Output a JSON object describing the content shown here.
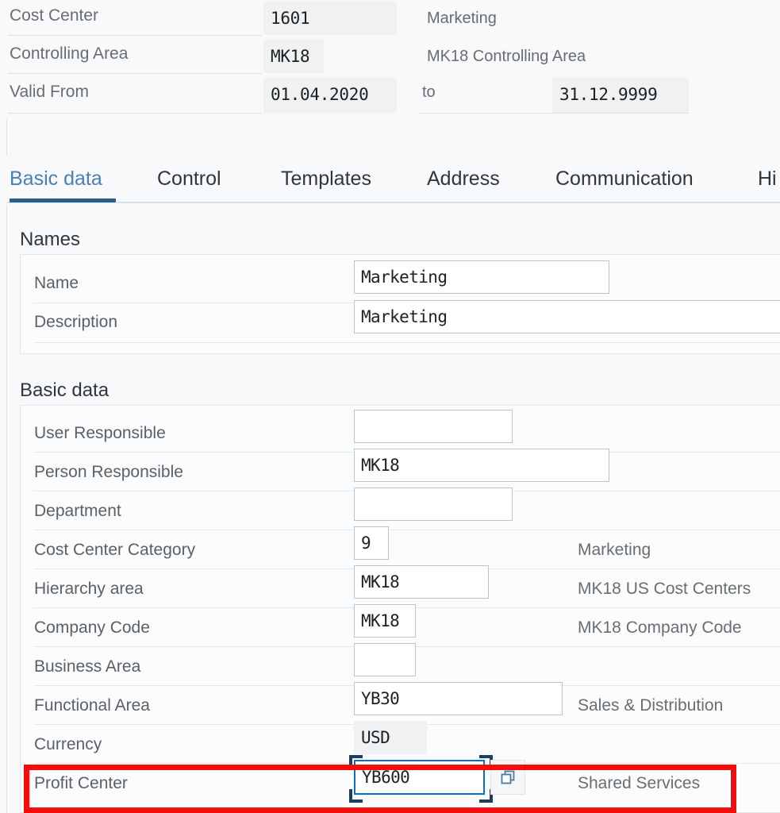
{
  "theme": {
    "page_bg": "#f7f9fb",
    "accent_blue": "#0a6ed1",
    "tab_active_text": "#4a7fb5",
    "tab_marker": "#2b5d8b",
    "label_gray": "#5c6064",
    "desc_gray": "#6a6d70",
    "readonly_bg": "#eff1f3",
    "annotation_red": "#f50c0c",
    "focus_bracket": "#1c3f60"
  },
  "object_header": {
    "rows": [
      {
        "label": "Cost Center",
        "value": "1601",
        "description": "Marketing"
      },
      {
        "label": "Controlling Area",
        "value": "MK18",
        "description": "MK18 Controlling Area"
      },
      {
        "label": "Valid From",
        "value": "01.04.2020",
        "to_label": "to",
        "to_value": "31.12.9999"
      }
    ]
  },
  "tabs": {
    "items": [
      {
        "label": "Basic data",
        "active": true
      },
      {
        "label": "Control",
        "active": false
      },
      {
        "label": "Templates",
        "active": false
      },
      {
        "label": "Address",
        "active": false
      },
      {
        "label": "Communication",
        "active": false
      },
      {
        "label": "Hi",
        "active": false,
        "truncated": true
      }
    ]
  },
  "sections": [
    {
      "title": "Names",
      "fields": [
        {
          "label": "Name",
          "value": "Marketing",
          "state": "editable",
          "description": ""
        },
        {
          "label": "Description",
          "value": "Marketing",
          "state": "editable",
          "description": ""
        }
      ]
    },
    {
      "title": "Basic data",
      "fields": [
        {
          "label": "User Responsible",
          "value": "",
          "state": "editable",
          "description": ""
        },
        {
          "label": "Person Responsible",
          "value": "MK18",
          "state": "editable",
          "description": ""
        },
        {
          "label": "Department",
          "value": "",
          "state": "editable",
          "description": ""
        },
        {
          "label": "Cost Center Category",
          "value": "9",
          "state": "editable",
          "description": "Marketing"
        },
        {
          "label": "Hierarchy area",
          "value": "MK18",
          "state": "editable",
          "description": "MK18 US Cost Centers"
        },
        {
          "label": "Company Code",
          "value": "MK18",
          "state": "editable",
          "description": "MK18 Company Code"
        },
        {
          "label": "Business Area",
          "value": "",
          "state": "editable",
          "description": ""
        },
        {
          "label": "Functional Area",
          "value": "YB30",
          "state": "editable",
          "description": "Sales & Distribution"
        },
        {
          "label": "Currency",
          "value": "USD",
          "state": "readonly",
          "description": ""
        },
        {
          "label": "Profit Center",
          "value": "YB600",
          "state": "focused",
          "description": "Shared Services",
          "value_help_icon": "copy-icon",
          "annotated": true
        }
      ]
    }
  ],
  "annotation": {
    "target_field": "Profit Center",
    "shape": "rectangle",
    "color": "#f50c0c"
  }
}
